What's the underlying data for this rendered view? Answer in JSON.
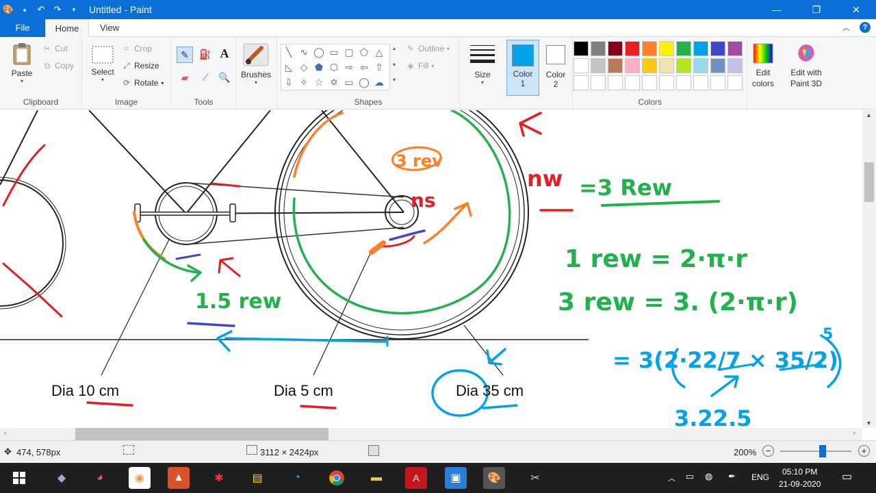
{
  "window": {
    "title": "Untitled - Paint",
    "quick_access_icons": [
      "paint-app-icon",
      "save-icon",
      "undo-icon",
      "redo-icon",
      "customize-dropdown-icon"
    ],
    "controls": [
      "minimize-icon",
      "maximize-icon",
      "close-icon"
    ]
  },
  "tabs": {
    "file": "File",
    "home": "Home",
    "view": "View"
  },
  "ribbon": {
    "clipboard": {
      "name": "Clipboard",
      "paste": "Paste",
      "cut": "Cut",
      "copy": "Copy"
    },
    "image": {
      "name": "Image",
      "select": "Select",
      "crop": "Crop",
      "resize": "Resize",
      "rotate": "Rotate"
    },
    "tools": {
      "name": "Tools"
    },
    "brushes": {
      "label": "Brushes"
    },
    "shapes": {
      "name": "Shapes",
      "outline": "Outline",
      "fill": "Fill"
    },
    "size": {
      "label": "Size"
    },
    "color1": {
      "label": "Color",
      "sub": "1",
      "value": "#00a2e8"
    },
    "color2": {
      "label": "Color",
      "sub": "2",
      "value": "#ffffff"
    },
    "colors": {
      "name": "Colors",
      "edit_label": "Edit colors",
      "paint3d_label": "Edit with Paint 3D"
    },
    "palette": [
      "#000000",
      "#7f7f7f",
      "#880015",
      "#ed1c24",
      "#ff7f27",
      "#fff200",
      "#22b14c",
      "#00a2e8",
      "#3f48cc",
      "#a349a4",
      "#ffffff",
      "#c3c3c3",
      "#b97a57",
      "#ffaec9",
      "#ffc90e",
      "#efe4b0",
      "#b5e61d",
      "#99d9ea",
      "#7092be",
      "#c8bfe7",
      "#ffffff",
      "#ffffff",
      "#ffffff",
      "#ffffff",
      "#ffffff",
      "#ffffff",
      "#ffffff",
      "#ffffff",
      "#ffffff",
      "#ffffff"
    ]
  },
  "canvas": {
    "labels": {
      "dia1": "Dia 10 cm",
      "dia2": "Dia 5 cm",
      "dia3": "Dia 35 cm"
    },
    "ink": {
      "rev_orange": "3 rev",
      "ns": "ns",
      "nw": "nw",
      "nw_eq": "=3 Rew",
      "rev_green_small": "1.5 rew",
      "eq1": "1 rew = 2·π·r",
      "eq2": "3 rew = 3. (2·π·r)",
      "eq3": "= 3(2·22/7 × 35/2)",
      "eq3_small": "5",
      "eq4": "3.22.5"
    }
  },
  "status": {
    "cursor_pos": "474, 578px",
    "image_size": "3112 × 2424px",
    "zoom": "200%",
    "zoom_level": 0.6
  },
  "taskbar": {
    "language": "ENG",
    "time": "05:10 PM",
    "date": "21-09-2020"
  }
}
